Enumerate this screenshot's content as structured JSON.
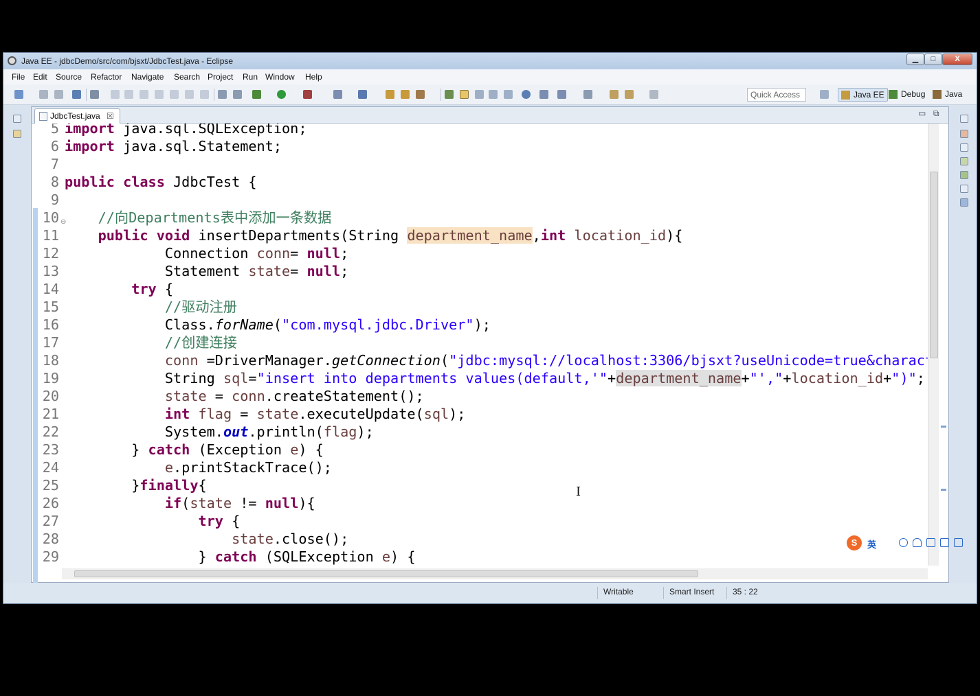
{
  "window": {
    "title": "Java EE - jdbcDemo/src/com/bjsxt/JdbcTest.java - Eclipse",
    "controls": {
      "minimize": "▁",
      "maximize": "□",
      "close": "X"
    }
  },
  "menu": {
    "items": [
      "File",
      "Edit",
      "Source",
      "Refactor",
      "Navigate",
      "Search",
      "Project",
      "Run",
      "Window",
      "Help"
    ]
  },
  "toolbar": {
    "quick_access_placeholder": "Quick Access",
    "perspectives": [
      "Java EE",
      "Debug",
      "Java"
    ]
  },
  "editor": {
    "tab_label": "JdbcTest.java",
    "tab_close": "☒",
    "panel_min": "▭",
    "panel_max": "⧉",
    "fold_marker": "⊖",
    "lines": [
      {
        "n": "5",
        "text": "import java.sql.SQLException;"
      },
      {
        "n": "6",
        "text": "import java.sql.Statement;"
      },
      {
        "n": "7",
        "text": ""
      },
      {
        "n": "8",
        "text": "public class JdbcTest {"
      },
      {
        "n": "9",
        "text": ""
      },
      {
        "n": "10",
        "text": "    //向Departments表中添加一条数据"
      },
      {
        "n": "11",
        "text": "    public void insertDepartments(String department_name,int location_id){"
      },
      {
        "n": "12",
        "text": "            Connection conn= null;"
      },
      {
        "n": "13",
        "text": "            Statement state= null;"
      },
      {
        "n": "14",
        "text": "        try {"
      },
      {
        "n": "15",
        "text": "            //驱动注册"
      },
      {
        "n": "16",
        "text": "            Class.forName(\"com.mysql.jdbc.Driver\");"
      },
      {
        "n": "17",
        "text": "            //创建连接"
      },
      {
        "n": "18",
        "text": "            conn =DriverManager.getConnection(\"jdbc:mysql://localhost:3306/bjsxt?useUnicode=true&charact"
      },
      {
        "n": "19",
        "text": "            String sql=\"insert into departments values(default,'\"+department_name+\"',\"+location_id+\")\";"
      },
      {
        "n": "20",
        "text": "            state = conn.createStatement();"
      },
      {
        "n": "21",
        "text": "            int flag = state.executeUpdate(sql);"
      },
      {
        "n": "22",
        "text": "            System.out.println(flag);"
      },
      {
        "n": "23",
        "text": "        } catch (Exception e) {"
      },
      {
        "n": "24",
        "text": "            e.printStackTrace();"
      },
      {
        "n": "25",
        "text": "        }finally{"
      },
      {
        "n": "26",
        "text": "            if(state != null){"
      },
      {
        "n": "27",
        "text": "                try {"
      },
      {
        "n": "28",
        "text": "                    state.close();"
      },
      {
        "n": "29",
        "text": "                } catch (SQLException e) {"
      }
    ]
  },
  "status": {
    "writable": "Writable",
    "insert_mode": "Smart Insert",
    "position": "35 : 22"
  },
  "ime": {
    "logo": "S",
    "lang": "英"
  },
  "colors": {
    "keyword": "#7f0055",
    "string": "#2a00ff",
    "comment": "#3f7f5f",
    "variable": "#6a3e3e",
    "field": "#0000c0"
  }
}
